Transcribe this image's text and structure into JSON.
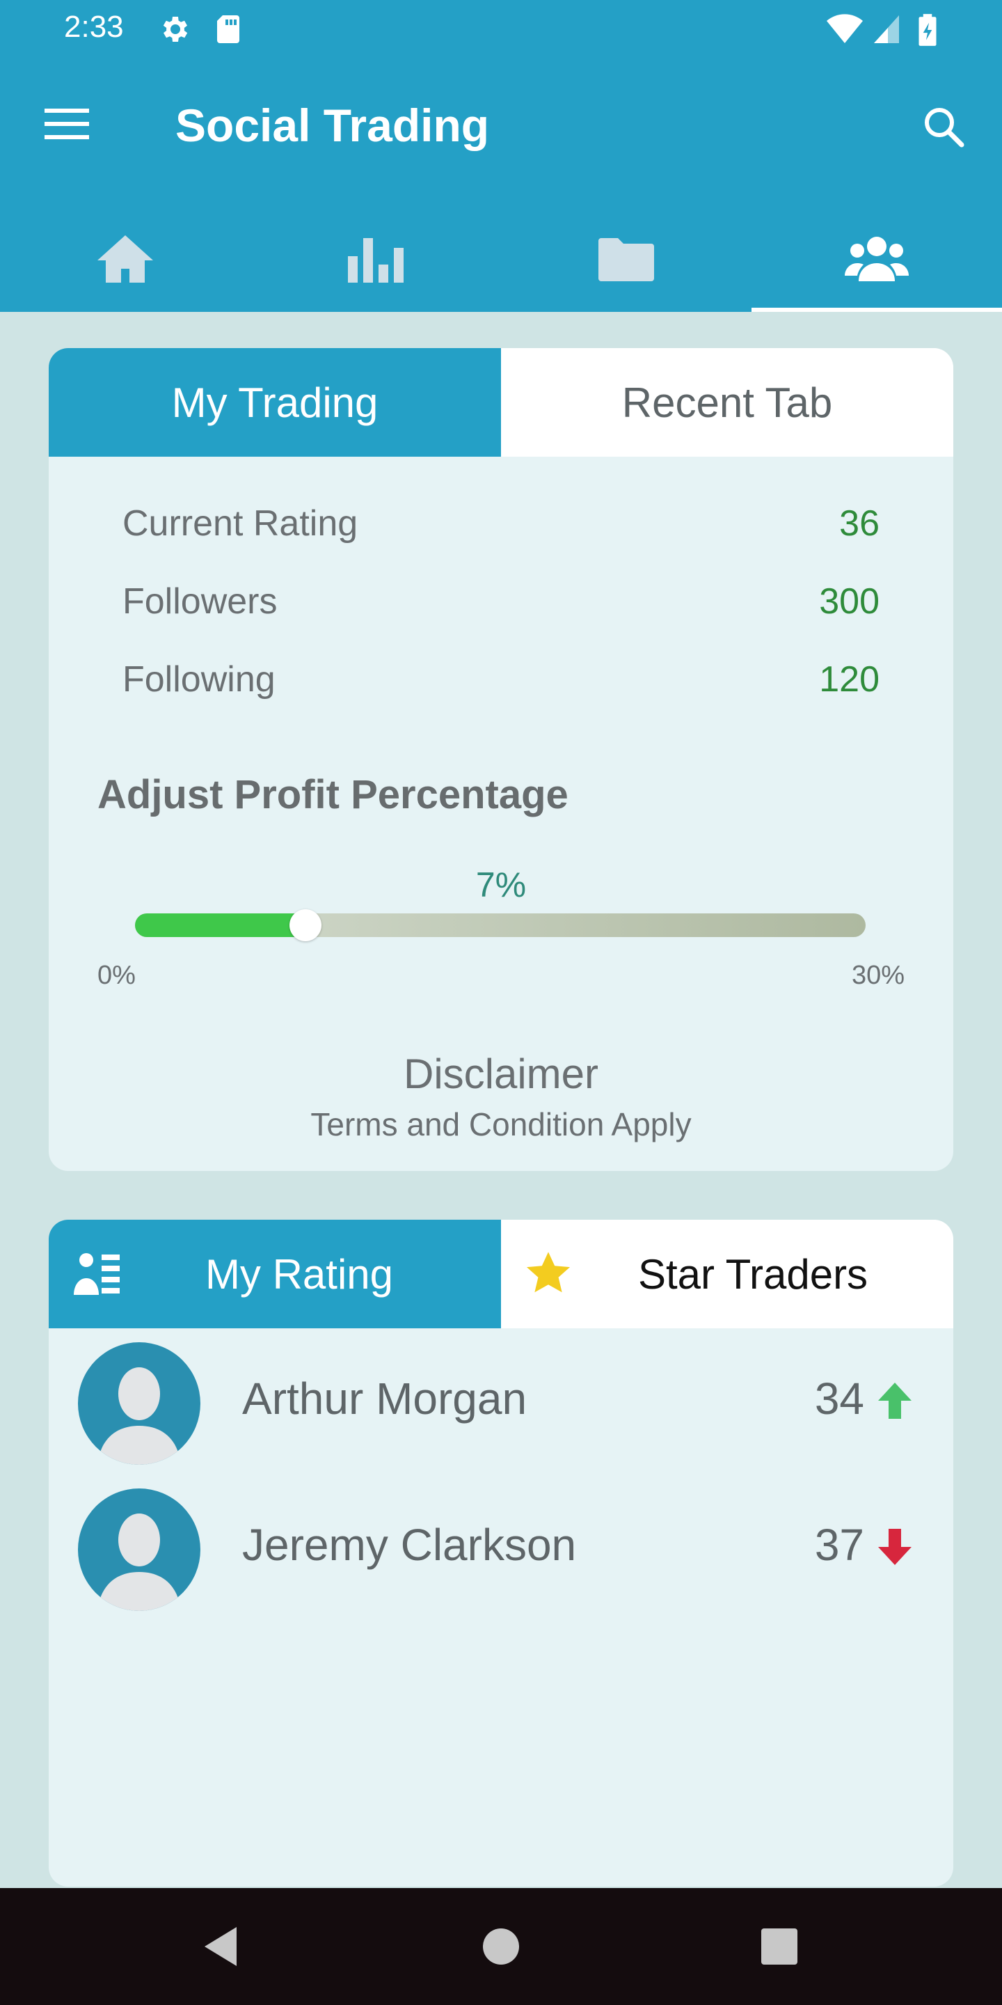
{
  "status_bar": {
    "time": "2:33",
    "icons": [
      "gear-icon",
      "sd-card-icon",
      "wifi-icon",
      "signal-icon",
      "battery-icon"
    ]
  },
  "toolbar": {
    "title": "Social Trading",
    "menu_icon": "hamburger-menu-icon",
    "search_icon": "search-icon"
  },
  "nav_tabs": [
    {
      "icon": "home-icon",
      "active": false
    },
    {
      "icon": "bar-chart-icon",
      "active": false
    },
    {
      "icon": "folder-icon",
      "active": false
    },
    {
      "icon": "people-icon",
      "active": true
    }
  ],
  "trading_card": {
    "tabs": [
      {
        "label": "My Trading",
        "active": true
      },
      {
        "label": "Recent Tab",
        "active": false
      }
    ],
    "stats": [
      {
        "label": "Current Rating",
        "value": "36"
      },
      {
        "label": "Followers",
        "value": "300"
      },
      {
        "label": "Following",
        "value": "120"
      }
    ],
    "profit_section_title": "Adjust Profit Percentage",
    "slider": {
      "value_label": "7%",
      "value": 7,
      "min": 0,
      "max": 30,
      "min_label": "0%",
      "max_label": "30%"
    },
    "disclaimer_title": "Disclaimer",
    "disclaimer_subtitle": "Terms and Condition Apply"
  },
  "rating_card": {
    "tabs": [
      {
        "label": "My Rating",
        "icon": "rating-list-icon",
        "active": true
      },
      {
        "label": "Star Traders",
        "icon": "star-icon",
        "active": false
      }
    ],
    "traders": [
      {
        "name": "Arthur Morgan",
        "score": "34",
        "trend": "up"
      },
      {
        "name": "Jeremy Clarkson",
        "score": "37",
        "trend": "down"
      }
    ]
  },
  "colors": {
    "primary": "#24a0c6",
    "positive": "#2e8b3a",
    "trend_up": "#49c16a",
    "trend_down": "#d7263d",
    "slider_fill": "#3fc84a"
  }
}
